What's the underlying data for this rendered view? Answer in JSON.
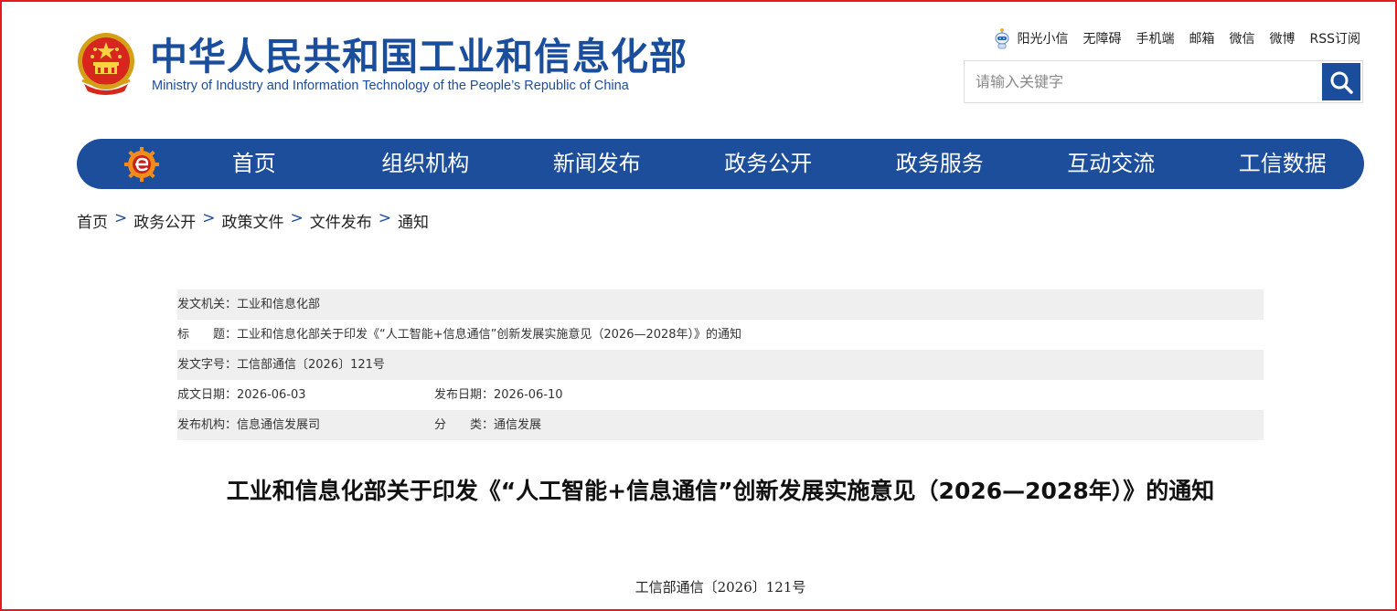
{
  "header": {
    "logo_cn": "中华人民共和国工业和信息化部",
    "logo_en": "Ministry of Industry and Information Technology of the People’s Republic of China",
    "top_links": {
      "sunny": "阳光小信",
      "accessibility": "无障碍",
      "mobile": "手机端",
      "mail": "邮箱",
      "wechat": "微信",
      "weibo": "微博",
      "rss": "RSS订阅"
    },
    "search": {
      "placeholder": "请输入关键字"
    }
  },
  "nav": {
    "items": [
      "首页",
      "组织机构",
      "新闻发布",
      "政务公开",
      "政务服务",
      "互动交流",
      "工信数据"
    ]
  },
  "breadcrumb": [
    "首页",
    "政务公开",
    "政策文件",
    "文件发布",
    "通知"
  ],
  "breadcrumb_separator": ">",
  "info": {
    "issuer_label": "发文机关：",
    "issuer": "工业和信息化部",
    "title_label": "标　　题：",
    "title": "工业和信息化部关于印发《“人工智能+信息通信”创新发展实施意见（2026—2028年）》的通知",
    "doc_no_label": "发文字号：",
    "doc_no": "工信部通信〔2026〕121号",
    "created_label": "成文日期：",
    "created": "2026-06-03",
    "published_label": "发布日期：",
    "published": "2026-06-10",
    "org_label": "发布机构：",
    "org": "信息通信发展司",
    "category_label": "分　　类：",
    "category": "通信发展"
  },
  "document": {
    "title": "工业和信息化部关于印发《“人工智能+信息通信”创新发展实施意见（2026—2028年）》的通知",
    "number": "工信部通信〔2026〕121号"
  },
  "colors": {
    "brand_blue": "#1c4e9c",
    "frame_red": "#e21b1b",
    "row_shade": "#efefef"
  }
}
